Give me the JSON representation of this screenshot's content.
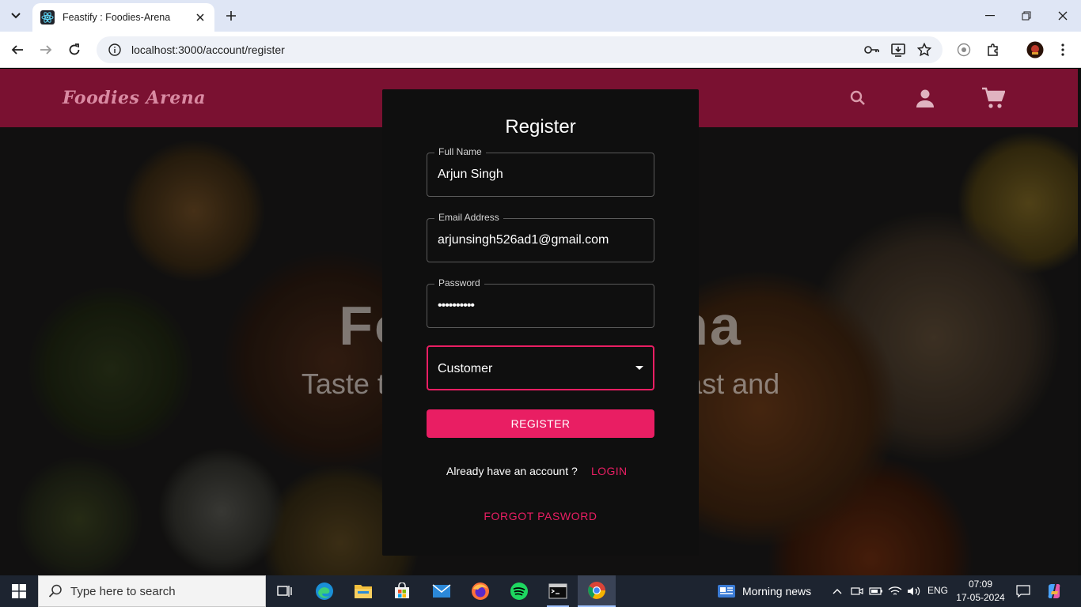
{
  "browser": {
    "tab_title": "Feastify : Foodies-Arena",
    "url": "localhost:3000/account/register"
  },
  "site": {
    "brand": "Foodies Arena",
    "hero_title": "Foodies Arena",
    "hero_subtitle": "Taste the best dishes, served fast and"
  },
  "register": {
    "heading": "Register",
    "full_name_label": "Full Name",
    "full_name_value": "Arjun Singh",
    "email_label": "Email Address",
    "email_value": "arjunsingh526ad1@gmail.com",
    "password_label": "Password",
    "password_value": "••••••••••",
    "role_value": "Customer",
    "register_button": "REGISTER",
    "already_text": "Already have an account ?",
    "login_link": "LOGIN",
    "forgot_link": "FORGOT PASWORD"
  },
  "taskbar": {
    "search_placeholder": "Type here to search",
    "news": "Morning news",
    "language": "ENG",
    "time": "07:09",
    "date": "17-05-2024"
  },
  "colors": {
    "header": "#7a1131",
    "accent": "#e91e63",
    "modal": "#0f0f0f"
  }
}
